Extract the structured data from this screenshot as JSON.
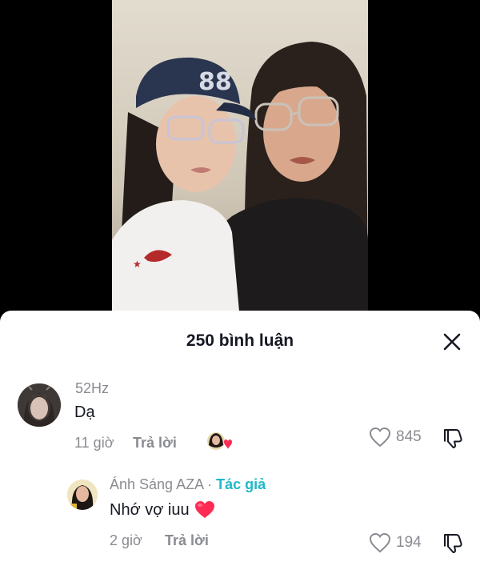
{
  "video": {
    "caption": "· ‥ ‥· ···"
  },
  "comments_sheet": {
    "title": "250 bình luận",
    "close_icon": "close-icon"
  },
  "comments": [
    {
      "username": "52Hz",
      "text": "Dạ",
      "time": "11 giờ",
      "reply_label": "Trả lời",
      "like_count": "845",
      "creator_liked": true
    },
    {
      "username": "Ánh Sáng AZA",
      "author_badge": "Tác giả",
      "separator": " · ",
      "text": "Nhớ vợ iuu",
      "emoji": "heart-emoji",
      "time": "2 giờ",
      "reply_label": "Trả lời",
      "like_count": "194"
    }
  ],
  "colors": {
    "author_badge": "#20b8c8",
    "heart": "#fe2c55",
    "secondary_text": "#8a8b91",
    "primary_text": "#161823"
  }
}
